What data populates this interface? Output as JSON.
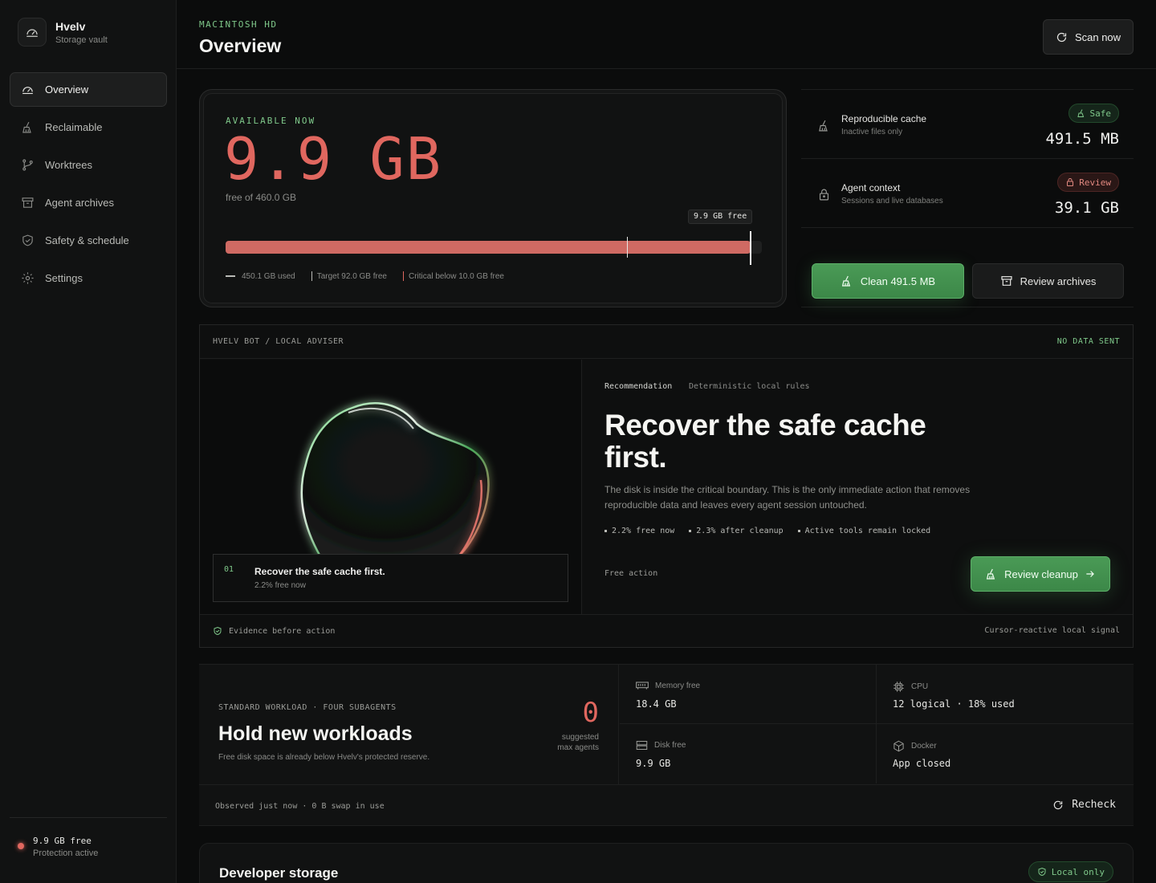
{
  "brand": {
    "name": "Hvelv",
    "subtitle": "Storage vault"
  },
  "nav": {
    "items": [
      {
        "label": "Overview",
        "icon": "gauge-icon",
        "active": true
      },
      {
        "label": "Reclaimable",
        "icon": "broom-icon"
      },
      {
        "label": "Worktrees",
        "icon": "git-branch-icon"
      },
      {
        "label": "Agent archives",
        "icon": "archive-icon"
      },
      {
        "label": "Safety & schedule",
        "icon": "shield-icon"
      },
      {
        "label": "Settings",
        "icon": "gear-icon"
      }
    ]
  },
  "sidebar_footer": {
    "free": "9.9 GB free",
    "status": "Protection active",
    "status_color": "#e0675f"
  },
  "header": {
    "breadcrumb": "MACINTOSH HD",
    "title": "Overview",
    "scan_label": "Scan now"
  },
  "storage": {
    "available_label": "AVAILABLE NOW",
    "available_value": "9.9 GB",
    "free_of": "free of 460.0 GB",
    "free_chip": "9.9 GB free",
    "used_gb": 450.1,
    "total_gb": 460.0,
    "target_free_gb": 92.0,
    "critical_free_gb": 10.0,
    "legend_used": "450.1 GB used",
    "legend_target": "Target 92.0 GB free",
    "legend_critical": "Critical below 10.0 GB free"
  },
  "buckets": [
    {
      "title": "Reproducible cache",
      "subtitle": "Inactive files only",
      "badge": "Safe",
      "value": "491.5 MB"
    },
    {
      "title": "Agent context",
      "subtitle": "Sessions and live databases",
      "badge": "Review",
      "value": "39.1 GB"
    }
  ],
  "actions": {
    "clean_label": "Clean 491.5 MB",
    "review_archives_label": "Review archives"
  },
  "bot": {
    "header_left": "HVELV BOT / LOCAL ADVISER",
    "header_right": "NO DATA SENT",
    "card_num": "01",
    "card_title": "Recover the safe cache first.",
    "card_sub": "2.2% free now",
    "rec_tag": "Recommendation",
    "rec_tag2": "Deterministic local rules",
    "rec_heading": "Recover the safe cache first.",
    "rec_body": "The disk is inside the critical boundary. This is the only immediate action that removes reproducible data and leaves every agent session untouched.",
    "points": [
      "2.2% free now",
      "2.3% after cleanup",
      "Active tools remain locked"
    ],
    "free_action": "Free action",
    "review_cleanup_label": "Review cleanup",
    "footer_left": "Evidence before action",
    "footer_right": "Cursor-reactive local signal"
  },
  "workload": {
    "tag": "STANDARD WORKLOAD · FOUR SUBAGENTS",
    "heading": "Hold new workloads",
    "sub": "Free disk space is already below Hvelv's protected reserve.",
    "agents": "0",
    "agents_label": "suggested max agents",
    "stats": [
      {
        "label": "Memory free",
        "value": "18.4 GB",
        "icon": "memory-icon"
      },
      {
        "label": "CPU",
        "value": "12 logical · 18% used",
        "icon": "cpu-icon"
      },
      {
        "label": "Disk free",
        "value": "9.9 GB",
        "icon": "disk-icon"
      },
      {
        "label": "Docker",
        "value": "App closed",
        "icon": "cube-icon"
      }
    ],
    "footer": "Observed just now · 0 B swap in use",
    "recheck_label": "Recheck"
  },
  "developer": {
    "heading": "Developer storage",
    "badge": "Local only"
  },
  "colors": {
    "accent_green": "#7fc88a",
    "accent_red": "#e0675f",
    "bg": "#0b0c0c"
  }
}
